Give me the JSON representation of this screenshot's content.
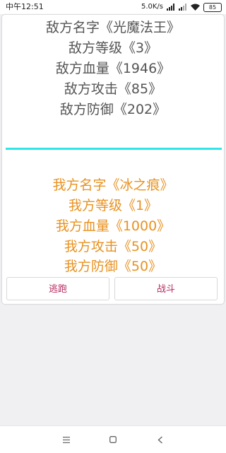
{
  "status_bar": {
    "time": "中午12:51",
    "speed": "5.0K/s",
    "battery": "85"
  },
  "enemy": {
    "name": "敌方名字《光魔法王》",
    "level": "敌方等级《3》",
    "hp": "敌方血量《1946》",
    "attack": "敌方攻击《85》",
    "defense": "敌方防御《202》"
  },
  "player": {
    "name": "我方名字《冰之痕》",
    "level": "我方等级《1》",
    "hp": "我方血量《1000》",
    "attack": "我方攻击《50》",
    "defense": "我方防御《50》"
  },
  "actions": {
    "flee_label": "逃跑",
    "fight_label": "战斗"
  },
  "colors": {
    "enemy_text": "#555555",
    "player_text": "#e89220",
    "divider": "#2ee6e6",
    "button_text": "#b8285e"
  }
}
